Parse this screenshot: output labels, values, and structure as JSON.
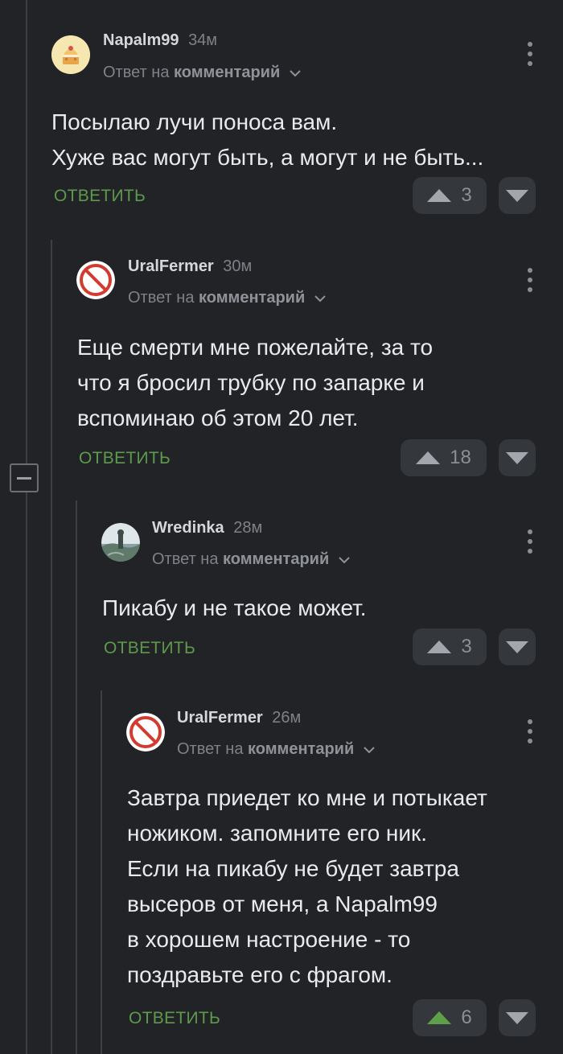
{
  "comments": [
    {
      "author": "Napalm99",
      "time": "34м",
      "reply_prefix": "Ответ на",
      "reply_link": "комментарий",
      "lines": [
        "Посылаю лучи поноса вам.",
        "Хуже вас могут быть, а могут и не быть..."
      ],
      "reply_label": "ОТВЕТИТЬ",
      "score": "3",
      "avatar_icon": "cake-avatar-icon"
    },
    {
      "author": "UralFermer",
      "time": "30м",
      "reply_prefix": "Ответ на",
      "reply_link": "комментарий",
      "lines": [
        "Еще смерти мне пожелайте, за то",
        "что я бросил трубку по запарке и",
        "вспоминаю об этом 20 лет."
      ],
      "reply_label": "ОТВЕТИТЬ",
      "score": "18",
      "avatar_icon": "no-entry-avatar-icon"
    },
    {
      "author": "Wredinka",
      "time": "28м",
      "reply_prefix": "Ответ на",
      "reply_link": "комментарий",
      "lines": [
        "Пикабу и не такое может."
      ],
      "reply_label": "ОТВЕТИТЬ",
      "score": "3",
      "avatar_icon": "landscape-avatar-icon"
    },
    {
      "author": "UralFermer",
      "time": "26м",
      "reply_prefix": "Ответ на",
      "reply_link": "комментарий",
      "lines": [
        "Завтра приедет ко мне и потыкает",
        "ножиком. запомните его ник.",
        "Если на пикабу не будет завтра",
        "высеров от меня, а Napalm99",
        "в хорошем настроение - то",
        "поздравьте его с фрагом."
      ],
      "reply_label": "ОТВЕТИТЬ",
      "score": "6",
      "upvoted": true,
      "avatar_icon": "no-entry-avatar-icon"
    }
  ],
  "colors": {
    "background": "#212326",
    "reply_green": "#5e9a4c",
    "upvote_active": "#5ea04a",
    "arrow_inactive": "#a3a7ad"
  }
}
